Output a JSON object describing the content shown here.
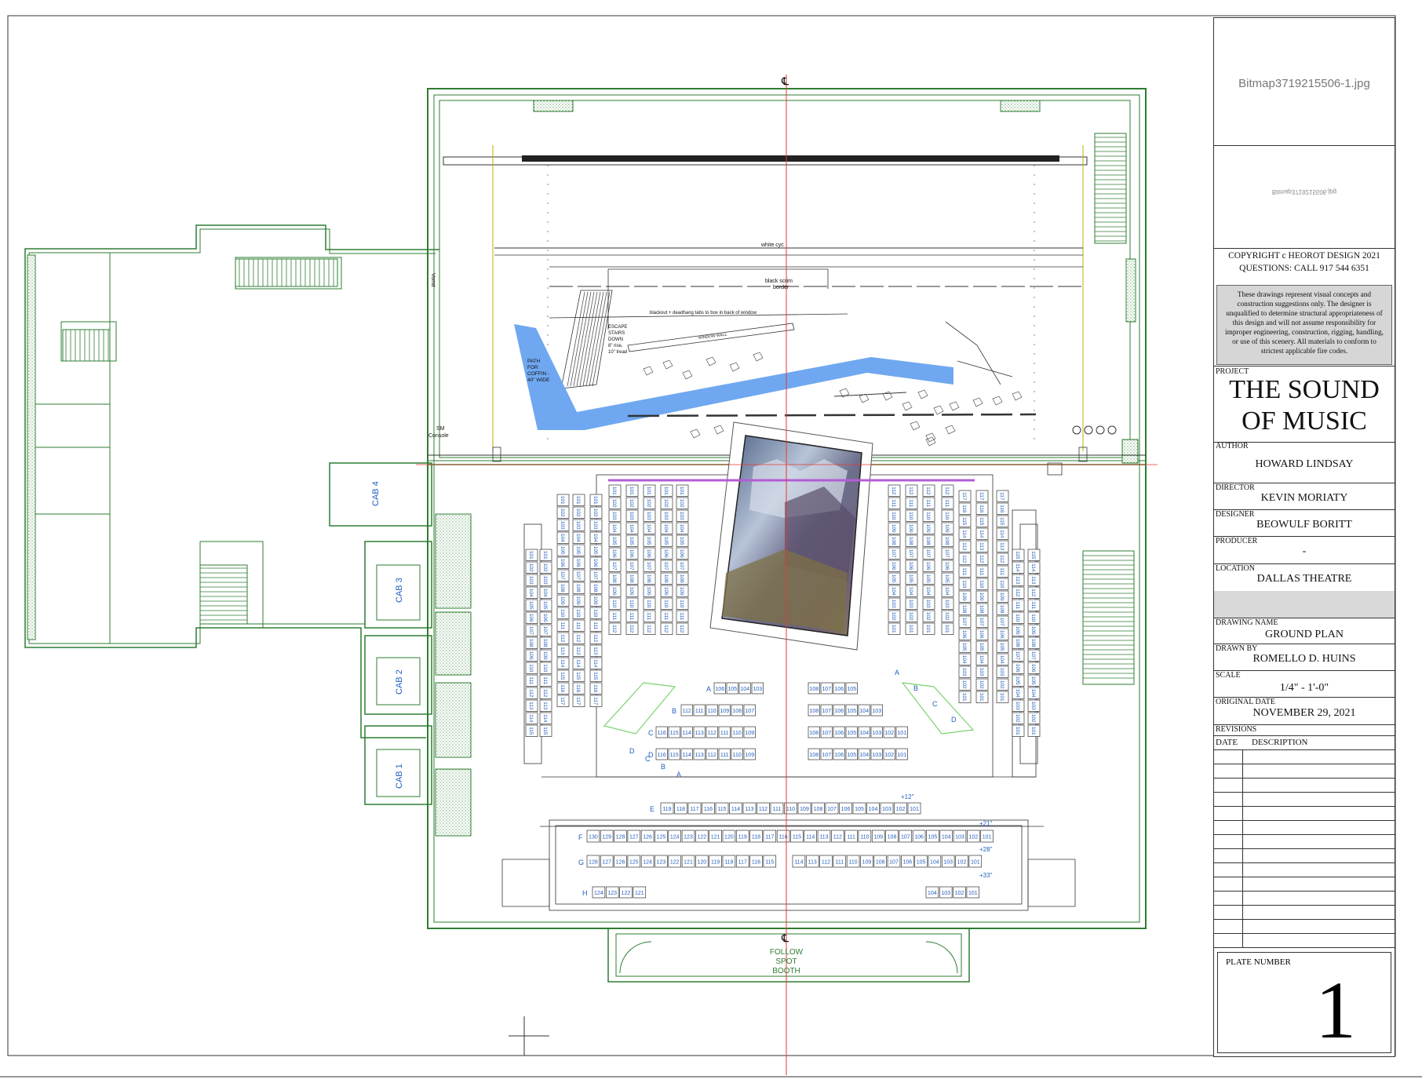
{
  "drawing": {
    "centerline_symbol": "℄",
    "bitmap_label": "Bitmap3719215506-1.jpg",
    "bitmap_label_flipped": "Bitmap3719215506.jpg",
    "labels": {
      "white_cyc": "white cyc",
      "black_scrim": "black scrim",
      "border": "border",
      "blackout": "blackout + deadhang tabs to box in back of window",
      "window_wall": "WINDOW WALL",
      "escape_stairs": [
        "ESCAPE",
        "STAIRS",
        "DOWN",
        "8\" rise,",
        "10\" tread"
      ],
      "path_coffin": [
        "PATH",
        "FOR",
        "COFFIN -",
        "40\" WIDE"
      ],
      "vomit": "Vomit",
      "sm_console": [
        "SM",
        "Console"
      ],
      "cab4": "CAB 4",
      "cab3": "CAB 3",
      "cab2": "CAB 2",
      "cab1": "CAB 1",
      "follow_spot": [
        "FOLLOW",
        "SPOT",
        "BOOTH"
      ],
      "riser_e": "+12\"",
      "riser_f": "+21\"",
      "riser_g": "+28\"",
      "riser_h": "+33\""
    },
    "rows": {
      "E": [
        "119",
        "118",
        "117",
        "116",
        "115",
        "114",
        "113",
        "112",
        "111",
        "110",
        "109",
        "108",
        "107",
        "106",
        "105",
        "104",
        "103",
        "102",
        "101"
      ],
      "F": [
        "130",
        "129",
        "128",
        "127",
        "126",
        "125",
        "124",
        "123",
        "122",
        "121",
        "120",
        "119",
        "118",
        "117",
        "116",
        "115",
        "114",
        "113",
        "112",
        "111",
        "110",
        "109",
        "108",
        "107",
        "106",
        "105",
        "104",
        "103",
        "102",
        "101"
      ],
      "G": [
        "128",
        "127",
        "126",
        "125",
        "124",
        "123",
        "122",
        "121",
        "120",
        "119",
        "118",
        "117",
        "116",
        "115",
        "114",
        "113",
        "112",
        "111",
        "110",
        "109",
        "108",
        "107",
        "106",
        "105",
        "104",
        "103",
        "102",
        "101"
      ],
      "H_left": [
        "124",
        "123",
        "122",
        "121"
      ],
      "H_right": [
        "104",
        "103",
        "102",
        "101"
      ],
      "A_left": [
        "106",
        "105",
        "104",
        "103"
      ],
      "A_right": [
        "108",
        "107",
        "106",
        "105"
      ],
      "B_left": [
        "112",
        "111",
        "110",
        "109",
        "108",
        "107"
      ],
      "B_right": [
        "108",
        "107",
        "106",
        "105",
        "104",
        "103"
      ],
      "C_left": [
        "116",
        "115",
        "114",
        "113",
        "112",
        "111",
        "110",
        "109"
      ],
      "C_right": [
        "108",
        "107",
        "106",
        "105",
        "104",
        "103",
        "102",
        "101"
      ],
      "D_left": [
        "116",
        "115",
        "114",
        "113",
        "112",
        "111",
        "110",
        "109"
      ],
      "D_right": [
        "108",
        "107",
        "106",
        "105",
        "104",
        "103",
        "102",
        "101"
      ],
      "side_col": [
        "101",
        "102",
        "103",
        "104",
        "105",
        "106",
        "107",
        "108",
        "109",
        "110",
        "111",
        "112",
        "113",
        "114",
        "115",
        "116",
        "117"
      ]
    },
    "row_letters": [
      "A",
      "B",
      "C",
      "D",
      "E",
      "F",
      "G",
      "H"
    ]
  },
  "titleblock": {
    "copyright": "COPYRIGHT  c  HEOROT DESIGN 2021",
    "questions": "QUESTIONS: CALL 917 544 6351",
    "disclaimer": "These drawings represent visual concepts and construction suggestions only. The designer is unqualified to determine structural appropriateness of this design and will not assume responsibility for improper engineering, construction, rigging, handling, or use of this scenery.  All materials to conform to strictest applicable fire codes.",
    "project_label": "PROJECT",
    "project": [
      "THE SOUND",
      "OF MUSIC"
    ],
    "author_label": "AUTHOR",
    "author": "HOWARD LINDSAY",
    "director_label": "DIRECTOR",
    "director": "KEVIN MORIATY",
    "designer_label": "DESIGNER",
    "designer": "BEOWULF BORITT",
    "producer_label": "PRODUCER",
    "producer": "-",
    "location_label": "LOCATION",
    "location": "DALLAS THEATRE",
    "drawing_name_label": "DRAWING NAME",
    "drawing_name": "GROUND PLAN",
    "drawn_by_label": "DRAWN BY",
    "drawn_by": "ROMELLO D. HUINS",
    "scale_label": "SCALE",
    "scale": "1/4\" - 1'-0\"",
    "original_date_label": "ORIGINAL DATE",
    "original_date": "NOVEMBER 29, 2021",
    "revisions_label": "REVISIONS",
    "date_col": "DATE",
    "description_col": "DESCRIPTION",
    "plate_label": "PLATE NUMBER",
    "plate_number": "1"
  },
  "colors": {
    "wall": "#2e7d32",
    "line": "#333333",
    "seat_text": "#1f5fbf",
    "path": "#6fa8f0",
    "center_line": "#e53935",
    "accent_violet": "#b45cd6"
  }
}
